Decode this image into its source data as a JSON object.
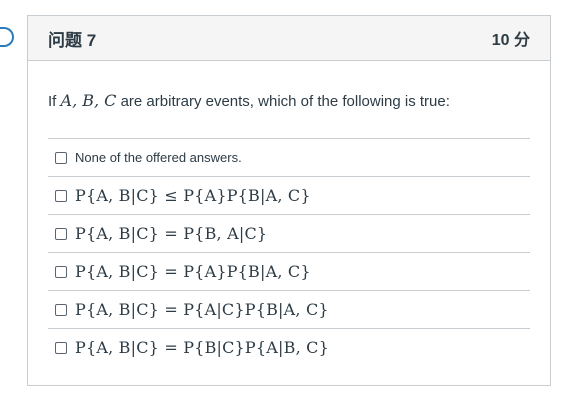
{
  "question": {
    "title": "问题 7",
    "points": "10 分",
    "prompt_prefix": "If ",
    "prompt_vars": "A, B, C",
    "prompt_suffix": " are arbitrary events, which of the following is true:"
  },
  "answers": [
    {
      "label": "None of the offered answers.",
      "is_math": false,
      "checked": false
    },
    {
      "label": "P{A, B|C} ≤ P{A}P{B|A, C}",
      "is_math": true,
      "checked": false
    },
    {
      "label": "P{A, B|C} = P{B, A|C}",
      "is_math": true,
      "checked": false
    },
    {
      "label": "P{A, B|C} = P{A}P{B|A, C}",
      "is_math": true,
      "checked": false
    },
    {
      "label": "P{A, B|C} = P{A|C}P{B|A, C}",
      "is_math": true,
      "checked": false
    },
    {
      "label": "P{A, B|C} = P{B|C}P{A|B, C}",
      "is_math": true,
      "checked": false
    }
  ],
  "colors": {
    "header_bg": "#f5f5f5",
    "border": "#c7cdd1",
    "text": "#2d3b45",
    "flag_accent": "#2b7abc"
  },
  "icons": {
    "flag": "flag-marker-icon",
    "checkbox": "checkbox-icon"
  }
}
